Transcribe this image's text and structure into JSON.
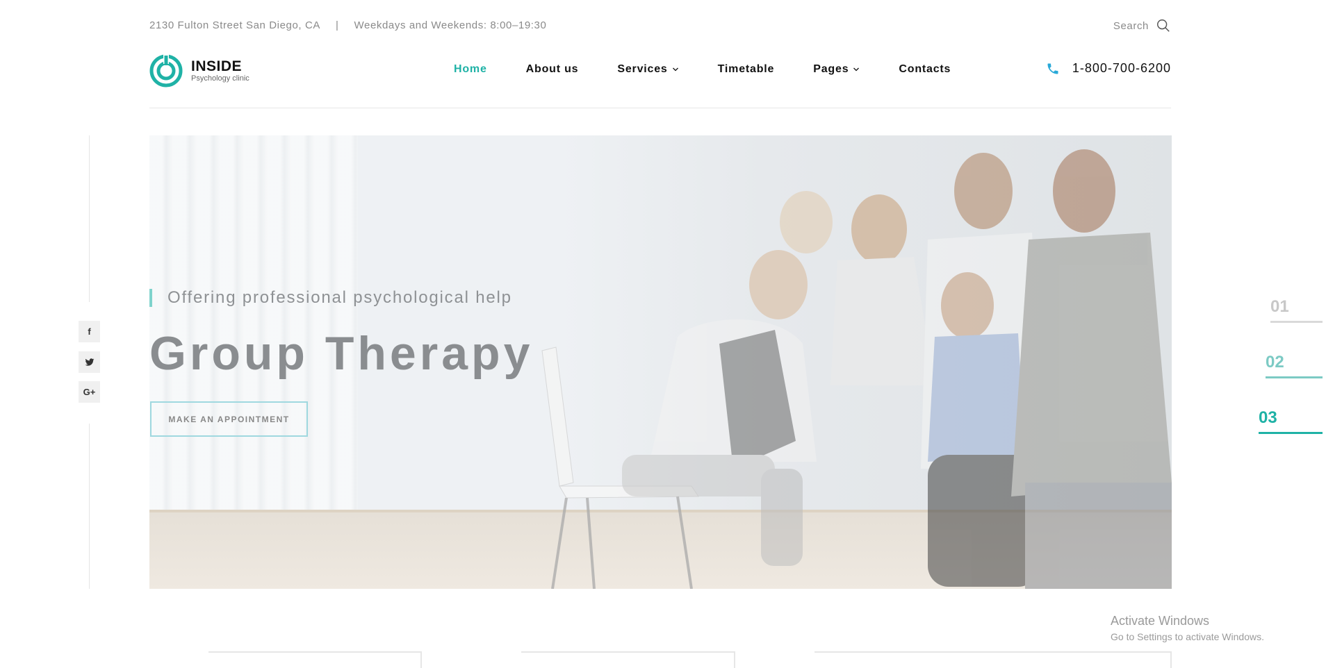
{
  "topbar": {
    "address": "2130 Fulton Street San Diego, CA",
    "separator": "|",
    "hours": "Weekdays and Weekends: 8:00–19:30",
    "search_label": "Search"
  },
  "header": {
    "logo_name": "INSIDE",
    "logo_tagline": "Psychology clinic",
    "nav": [
      {
        "label": "Home",
        "active": true
      },
      {
        "label": "About us"
      },
      {
        "label": "Services",
        "dropdown": true
      },
      {
        "label": "Timetable"
      },
      {
        "label": "Pages",
        "dropdown": true
      },
      {
        "label": "Contacts"
      }
    ],
    "phone": "1-800-700-6200"
  },
  "social": [
    {
      "icon": "facebook-icon",
      "glyph": "f"
    },
    {
      "icon": "twitter-icon",
      "glyph": "🐦"
    },
    {
      "icon": "google-plus-icon",
      "glyph": "G+"
    }
  ],
  "hero": {
    "kicker": "Offering professional psychological help",
    "title": "Group Therapy",
    "cta_label": "MAKE AN APPOINTMENT"
  },
  "slides": {
    "items": [
      "01",
      "02",
      "03"
    ],
    "active_index": 2
  },
  "watermark": {
    "line1": "Activate Windows",
    "line2": "Go to Settings to activate Windows."
  },
  "colors": {
    "accent": "#1fb2a6",
    "phone_icon": "#29a9d8"
  }
}
